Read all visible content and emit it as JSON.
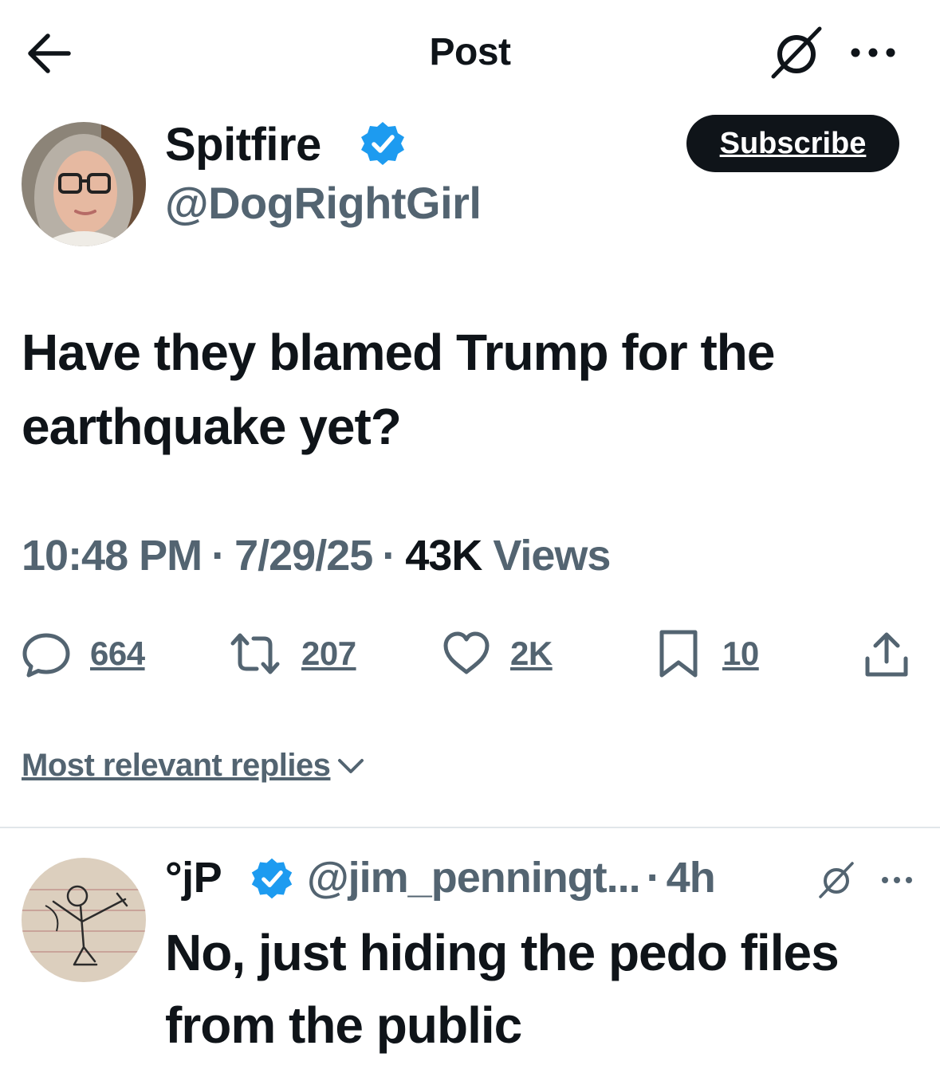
{
  "header": {
    "title": "Post",
    "back_icon": "arrow-left-icon",
    "grok_icon": "grok-icon",
    "more_icon": "more-horizontal-icon"
  },
  "post": {
    "display_name": "Spitfire",
    "handle": "@DogRightGirl",
    "verified": true,
    "verified_color": "#1d9bf0",
    "subscribe_label": "Subscribe",
    "text": "Have they blamed Trump for the earthquake yet?",
    "time": "10:48 PM",
    "date": "7/29/25",
    "views_count": "43K",
    "views_label": "Views",
    "separator": "·"
  },
  "actions": {
    "replies": "664",
    "reposts": "207",
    "likes": "2K",
    "bookmarks": "10"
  },
  "replies_sort": {
    "label": "Most relevant replies"
  },
  "reply": {
    "display_name": "°jP",
    "handle": "@jim_penningt...",
    "time": "4h",
    "separator": "·",
    "verified": true,
    "text": "No,  just hiding the pedo files from the public"
  },
  "colors": {
    "text_primary": "#0f1419",
    "text_secondary": "#536471",
    "divider": "#e1e6ea"
  }
}
